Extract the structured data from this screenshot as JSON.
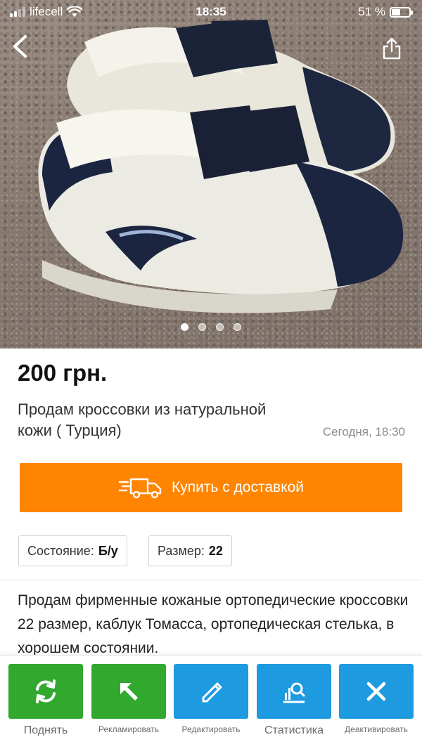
{
  "status_bar": {
    "carrier": "lifecell",
    "time": "18:35",
    "battery": "51 %",
    "battery_level": 0.51
  },
  "gallery": {
    "photo_count": 4,
    "active_index": 0
  },
  "listing": {
    "price": "200 грн.",
    "title": "Продам кроссовки из натуральной кожи ( Турция)",
    "date": "Сегодня, 18:30",
    "buy_label": "Купить с доставкой",
    "params": [
      {
        "label": "Состояние:",
        "value": "Б/у"
      },
      {
        "label": "Размер:",
        "value": "22"
      }
    ],
    "description": "Продам фирменные кожаные ортопедические кроссовки 22 размер, каблук Томасса, ортопедическая стелька, в хорошем состоянии."
  },
  "toolbar": {
    "items": [
      {
        "label": "Поднять",
        "icon": "refresh-icon",
        "color": "#32a82f"
      },
      {
        "label": "Рекламировать",
        "icon": "arrow-up-left-icon",
        "color": "#32a82f"
      },
      {
        "label": "Редактировать",
        "icon": "pencil-icon",
        "color": "#1e9be0"
      },
      {
        "label": "Статистика",
        "icon": "chart-search-icon",
        "color": "#1e9be0"
      },
      {
        "label": "Деактивировать",
        "icon": "close-icon",
        "color": "#1e9be0"
      }
    ]
  },
  "colors": {
    "accent_orange": "#ff8500",
    "green": "#32a82f",
    "blue": "#1e9be0"
  }
}
